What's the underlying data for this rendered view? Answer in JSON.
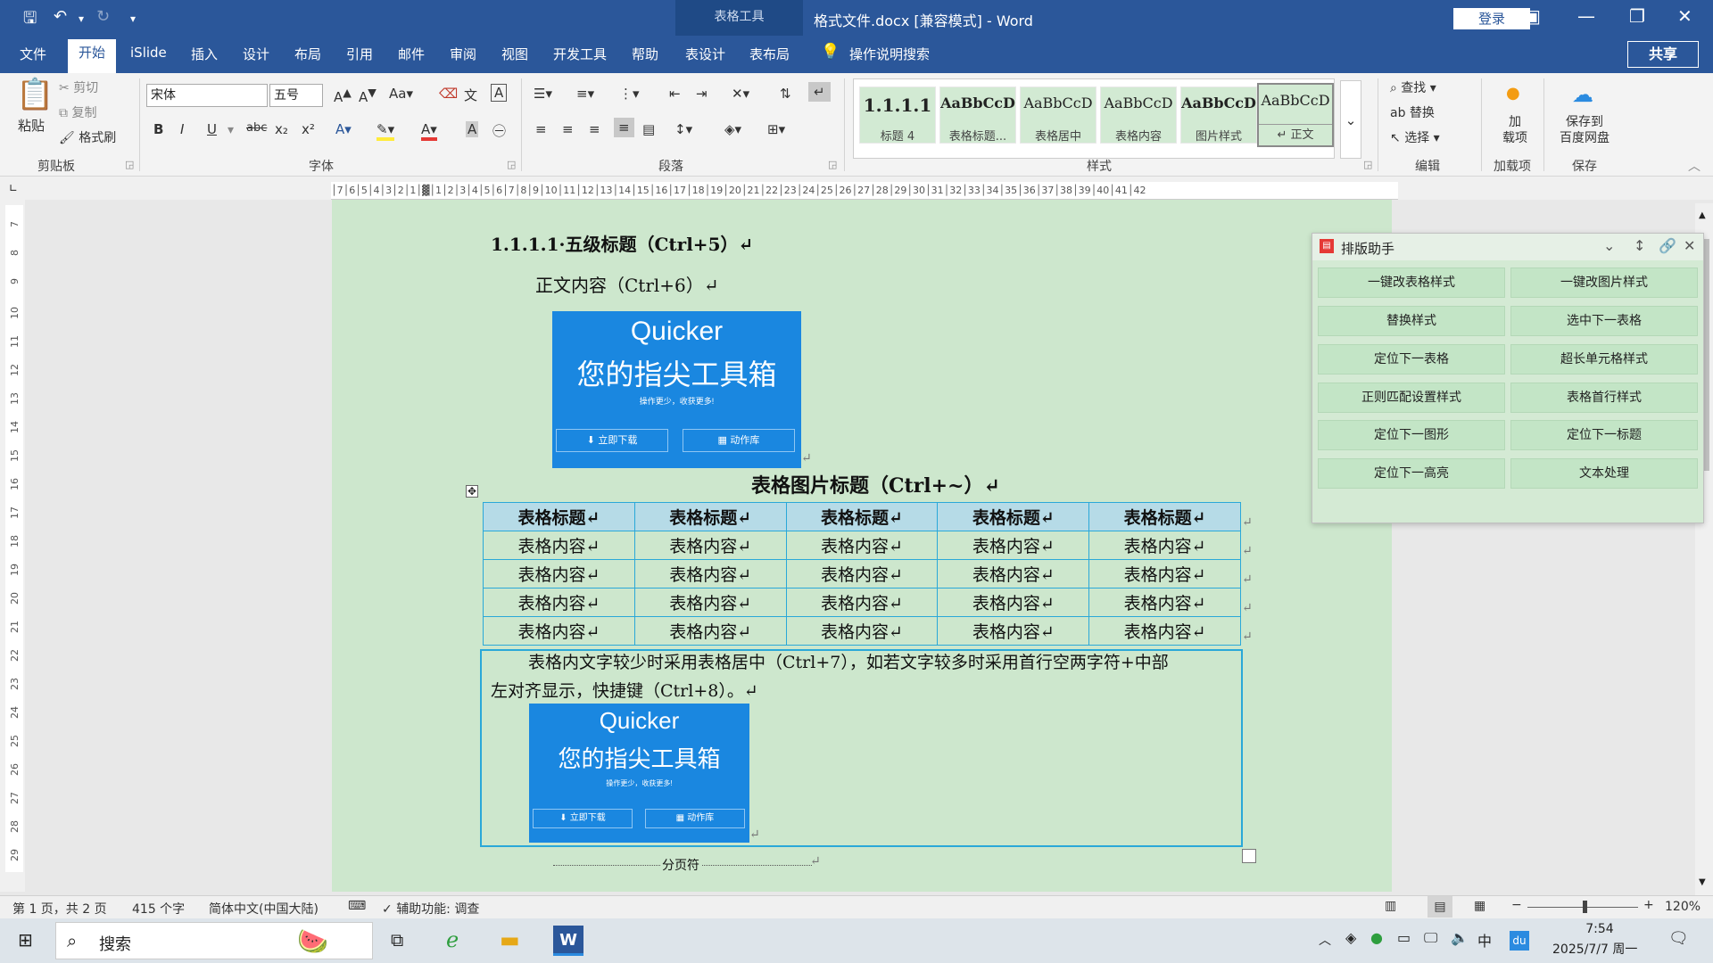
{
  "titlebar": {
    "context_tab": "表格工具",
    "title": "格式文件.docx [兼容模式] - Word",
    "login": "登录",
    "qat_redo_disabled": "↻"
  },
  "tabs": [
    "文件",
    "开始",
    "iSlide",
    "插入",
    "设计",
    "布局",
    "引用",
    "邮件",
    "审阅",
    "视图",
    "开发工具",
    "帮助",
    "表设计",
    "表布局"
  ],
  "tell_me": "操作说明搜索",
  "share": "共享",
  "ribbon": {
    "clipboard": {
      "paste": "粘贴",
      "cut": "剪切",
      "copy": "复制",
      "format_painter": "格式刷",
      "label": "剪贴板"
    },
    "font": {
      "name": "宋体",
      "size": "五号",
      "label": "字体"
    },
    "paragraph": {
      "label": "段落"
    },
    "styles": {
      "label": "样式",
      "items": [
        {
          "sample": "1.1.1.1",
          "name": "标题 4"
        },
        {
          "sample": "AaBbCcD",
          "name": "表格标题..."
        },
        {
          "sample": "AaBbCcD",
          "name": "表格居中"
        },
        {
          "sample": "AaBbCcD",
          "name": "表格内容"
        },
        {
          "sample": "AaBbCcD",
          "name": "图片样式"
        },
        {
          "sample": "AaBbCcD",
          "name": "↵ 正文"
        }
      ]
    },
    "editing": {
      "find": "查找",
      "replace": "替换",
      "select": "选择",
      "label": "编辑"
    },
    "addins": {
      "button": "加载项",
      "label": "加载项",
      "button_lines": [
        "加",
        "载项"
      ]
    },
    "save": {
      "button": "保存到百度网盘",
      "label": "保存",
      "button_lines": [
        "保存到",
        "百度网盘"
      ]
    }
  },
  "ruler_top": "│7│6│5│4│3│2│1│▓│1│2│3│4│5│6│7│8│9│10│11│12│13│14│15│16│17│18│19│20│21│22│23│24│25│26│27│28│29│30│31│32│33│34│35│36│37│38│39│40│41│42",
  "ruler_left": [
    "7",
    "8",
    "9",
    "10",
    "11",
    "12",
    "13",
    "14",
    "15",
    "16",
    "17",
    "18",
    "19",
    "20",
    "21",
    "22",
    "23",
    "24",
    "25",
    "26",
    "27",
    "28",
    "29"
  ],
  "document": {
    "heading5": "1.1.1.1·五级标题（Ctrl+5）↵",
    "body": "正文内容（Ctrl+6）↵",
    "promo": {
      "title": "Quicker",
      "subtitle": "您的指尖工具箱",
      "tagline": "操作更少，收获更多!",
      "btn1": "⬇ 立即下载",
      "btn2": "▦ 动作库"
    },
    "caption": "表格图片标题（Ctrl+~）↵",
    "table": {
      "header": [
        "表格标题↵",
        "表格标题↵",
        "表格标题↵",
        "表格标题↵",
        "表格标题↵"
      ],
      "rows": [
        [
          "表格内容↵",
          "表格内容↵",
          "表格内容↵",
          "表格内容↵",
          "表格内容↵"
        ],
        [
          "表格内容↵",
          "表格内容↵",
          "表格内容↵",
          "表格内容↵",
          "表格内容↵"
        ],
        [
          "表格内容↵",
          "表格内容↵",
          "表格内容↵",
          "表格内容↵",
          "表格内容↵"
        ],
        [
          "表格内容↵",
          "表格内容↵",
          "表格内容↵",
          "表格内容↵",
          "表格内容↵"
        ]
      ]
    },
    "para_line1": "表格内文字较少时采用表格居中（Ctrl+7），如若文字较多时采用首行空两字符+中部",
    "para_line2": "左对齐显示，快捷键（Ctrl+8）。↵",
    "page_break": "分页符"
  },
  "panel": {
    "title": "排版助手",
    "buttons": [
      "一键改表格样式",
      "一键改图片样式",
      "替换样式",
      "选中下一表格",
      "定位下一表格",
      "超长单元格样式",
      "正则匹配设置样式",
      "表格首行样式",
      "定位下一图形",
      "定位下一标题",
      "定位下一高亮",
      "文本处理"
    ]
  },
  "status": {
    "page": "第 1 页，共 2 页",
    "words": "415 个字",
    "lang": "简体中文(中国大陆)",
    "access": "辅助功能: 调查",
    "zoom": "120%"
  },
  "taskbar": {
    "search": "搜索",
    "time": "7:54",
    "date": "2025/7/7 周一",
    "ime": "中"
  }
}
